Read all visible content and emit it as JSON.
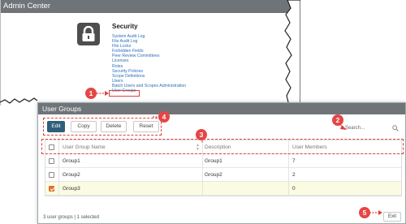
{
  "admin": {
    "title": "Admin Center",
    "section_title": "Security",
    "lock_icon": "lock-icon",
    "links": [
      "System Audit Log",
      "File Audit Log",
      "File Locks",
      "Forbidden Fields",
      "Peer Review Committees",
      "Licenses",
      "Roles",
      "Security Policies",
      "Scope Definitions",
      "Users",
      "Batch Users and Scopes Administration",
      "User Groups"
    ],
    "highlighted_link": "User Groups"
  },
  "callouts": [
    "1",
    "2",
    "3",
    "4",
    "5"
  ],
  "colors": {
    "callout": "#e64646",
    "titlebar": "#6f7479",
    "edit_button": "#2e5f78",
    "selected_row": "#fbfbe2",
    "checkbox_on": "#e0702b"
  },
  "dialog": {
    "title": "User Groups",
    "toolbar": {
      "edit": "Edit",
      "copy": "Copy",
      "delete": "Delete",
      "reset": "Reset"
    },
    "search": {
      "placeholder": "Search..."
    },
    "columns": [
      "User Group Name",
      "Description",
      "User Members"
    ],
    "rows": [
      {
        "name": "Group1",
        "description": "Group1",
        "members": "7",
        "selected": false
      },
      {
        "name": "Group2",
        "description": "Group2",
        "members": "2",
        "selected": false
      },
      {
        "name": "Group3",
        "description": "",
        "members": "0",
        "selected": true
      }
    ],
    "footer": "3 user groups | 1 selected",
    "exit": "Exit"
  }
}
